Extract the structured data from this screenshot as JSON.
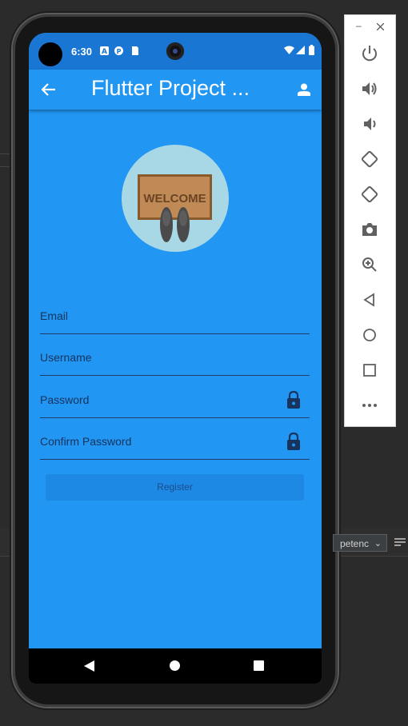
{
  "status_bar": {
    "time": "6:30"
  },
  "app_bar": {
    "title": "Flutter Project ..."
  },
  "illustration": {
    "mat_text": "WELCOME"
  },
  "form": {
    "email_label": "Email",
    "username_label": "Username",
    "password_label": "Password",
    "confirm_password_label": "Confirm Password",
    "register_button": "Register"
  },
  "ide": {
    "dropdown_text": "petenc"
  },
  "colors": {
    "primary": "#2196f3",
    "primary_dark": "#1976d2",
    "field_label": "#18335c",
    "button": "#1e88e5"
  },
  "icons": {
    "app_bar": [
      "back-arrow-icon",
      "person-icon"
    ],
    "fields": [
      "lock-icon"
    ],
    "emulator_panel": [
      "power-icon",
      "volume-up-icon",
      "volume-down-icon",
      "rotate-left-icon",
      "rotate-right-icon",
      "camera-icon",
      "zoom-in-icon",
      "back-icon",
      "home-icon",
      "overview-icon",
      "more-icon"
    ]
  }
}
